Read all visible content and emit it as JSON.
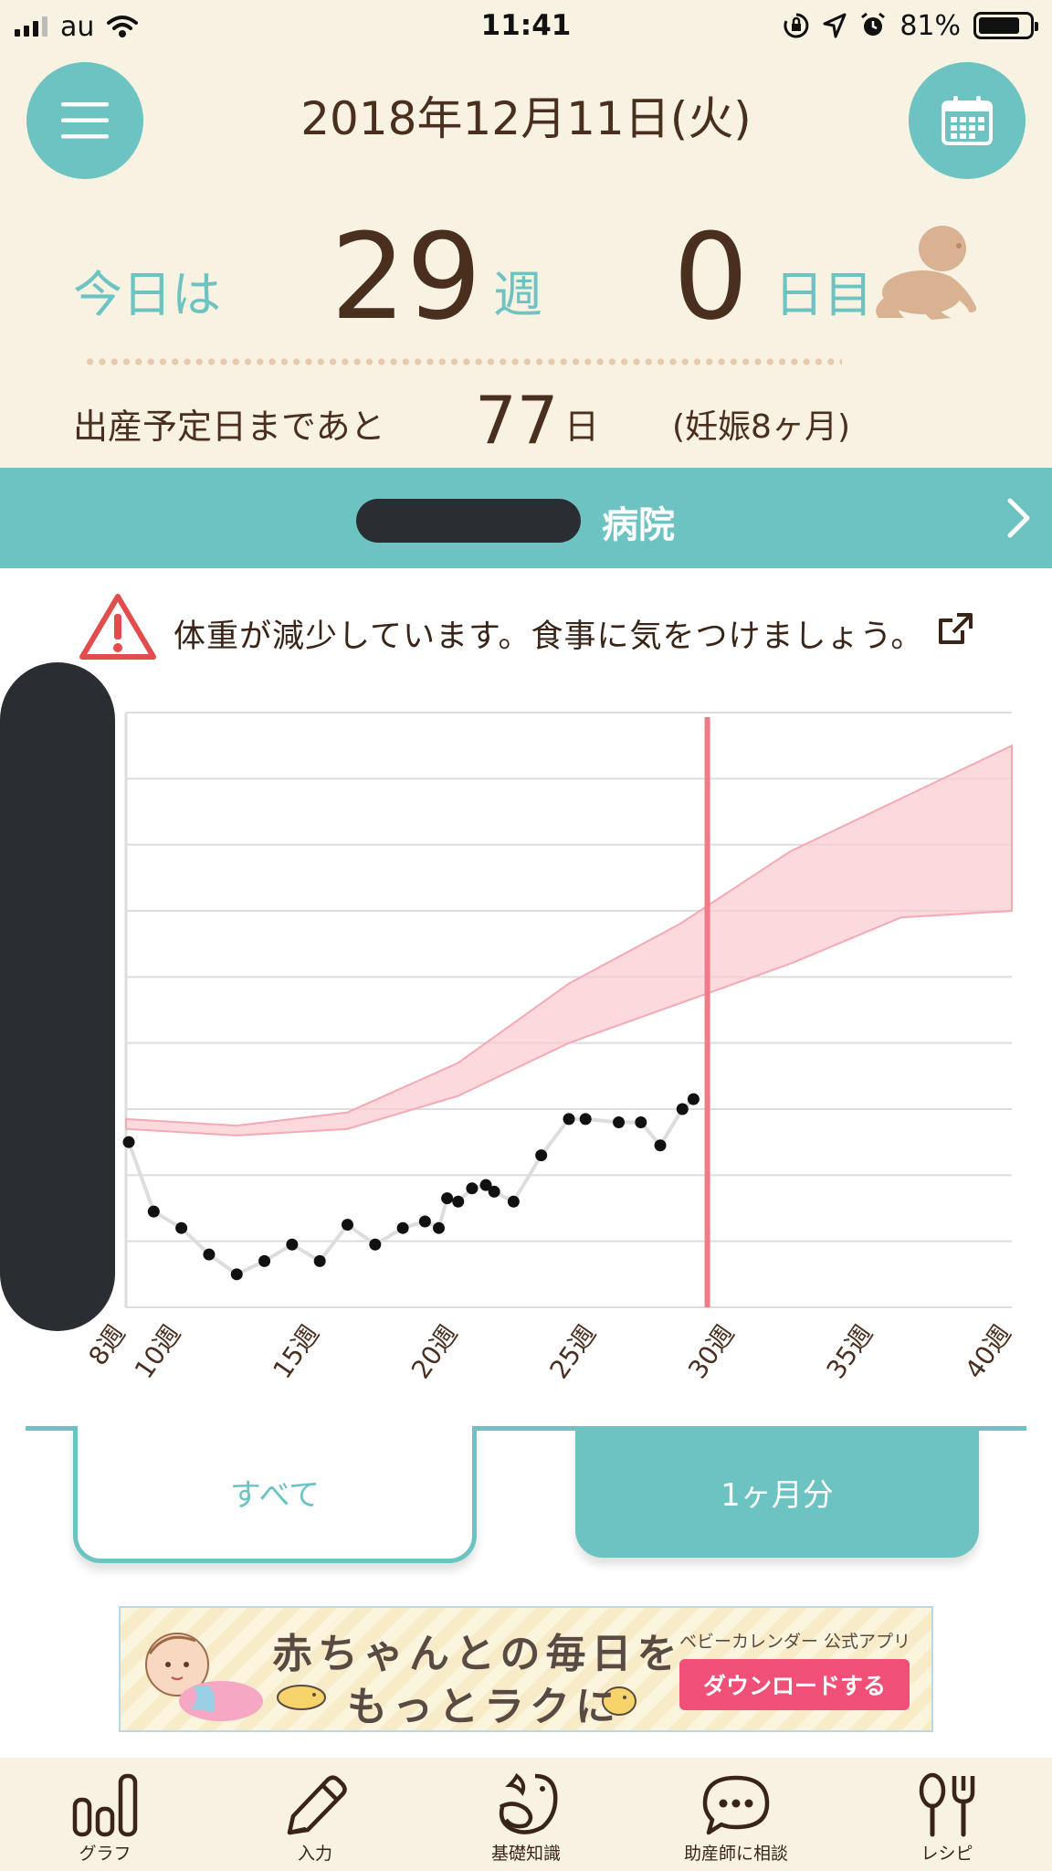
{
  "status_bar": {
    "carrier": "au",
    "time": "11:41",
    "battery": "81%",
    "battery_level": 0.81,
    "icons": [
      "signal-icon",
      "wifi-icon",
      "orientation-lock-icon",
      "location-icon",
      "alarm-icon",
      "battery-icon"
    ]
  },
  "header": {
    "date": "2018年12月11日(火)",
    "today_prefix": "今日は",
    "weeks": "29",
    "weeks_unit": "週",
    "days": "0",
    "days_unit": "日目",
    "due_label": "出産予定日まであと",
    "due_days": "77",
    "due_unit": "日",
    "month_info": "(妊娠8ヶ月)"
  },
  "hospital": {
    "name_suffix": "病院"
  },
  "warning": {
    "text": "体重が減少しています。食事に気をつけましょう。"
  },
  "chart_data": {
    "type": "scatter",
    "x_unit": "週",
    "xlim": [
      8,
      40
    ],
    "x_ticks": [
      "8週",
      "10週",
      "15週",
      "20週",
      "25週",
      "30週",
      "35週",
      "40週"
    ],
    "x_tick_values": [
      8,
      10,
      15,
      20,
      25,
      30,
      35,
      40
    ],
    "current_week": 29,
    "colors": {
      "points": "#111111",
      "line": "#dddddd",
      "band": "#f9c9cf",
      "band_edge": "#f4a9b3",
      "marker": "#ef7b86",
      "grid": "#dddddd"
    },
    "y_range": [
      0,
      9
    ],
    "grid_lines": 9,
    "series": [
      {
        "values": [
          [
            8.1,
            2.5
          ],
          [
            9.0,
            1.45
          ],
          [
            10.0,
            1.2
          ],
          [
            11.0,
            0.8
          ],
          [
            12.0,
            0.5
          ],
          [
            13.0,
            0.7
          ],
          [
            14.0,
            0.95
          ],
          [
            15.0,
            0.7
          ],
          [
            16.0,
            1.25
          ],
          [
            17.0,
            0.95
          ],
          [
            18.0,
            1.2
          ],
          [
            18.8,
            1.3
          ],
          [
            19.3,
            1.2
          ],
          [
            19.6,
            1.65
          ],
          [
            20.0,
            1.6
          ],
          [
            20.5,
            1.8
          ],
          [
            21.0,
            1.85
          ],
          [
            21.3,
            1.75
          ],
          [
            22.0,
            1.6
          ],
          [
            23.0,
            2.3
          ],
          [
            24.0,
            2.85
          ],
          [
            24.6,
            2.85
          ],
          [
            25.8,
            2.8
          ],
          [
            26.6,
            2.8
          ],
          [
            27.3,
            2.45
          ],
          [
            28.1,
            3.0
          ],
          [
            28.5,
            3.15
          ]
        ]
      }
    ],
    "reference_band": {
      "weeks": [
        8,
        12,
        16,
        20,
        24,
        28,
        32,
        36,
        40
      ],
      "lower": [
        2.7,
        2.6,
        2.7,
        3.2,
        4.0,
        4.6,
        5.2,
        5.9,
        6.0
      ],
      "upper": [
        2.85,
        2.75,
        2.95,
        3.7,
        4.9,
        5.8,
        6.9,
        7.7,
        8.5
      ]
    }
  },
  "tabs": {
    "all": "すべて",
    "month": "1ヶ月分",
    "selected": "month"
  },
  "banner": {
    "headline_1": "赤ちゃんとの毎日を",
    "headline_2": "もっとラクに",
    "sub": "ベビーカレンダー 公式アプリ",
    "button": "ダウンロードする"
  },
  "nav": {
    "items": [
      {
        "label": "グラフ",
        "icon": "graph-icon"
      },
      {
        "label": "入力",
        "icon": "pencil-icon"
      },
      {
        "label": "基礎知識",
        "icon": "stork-icon"
      },
      {
        "label": "助産師に相談",
        "icon": "chat-icon"
      },
      {
        "label": "レシピ",
        "icon": "cutlery-icon"
      }
    ]
  }
}
